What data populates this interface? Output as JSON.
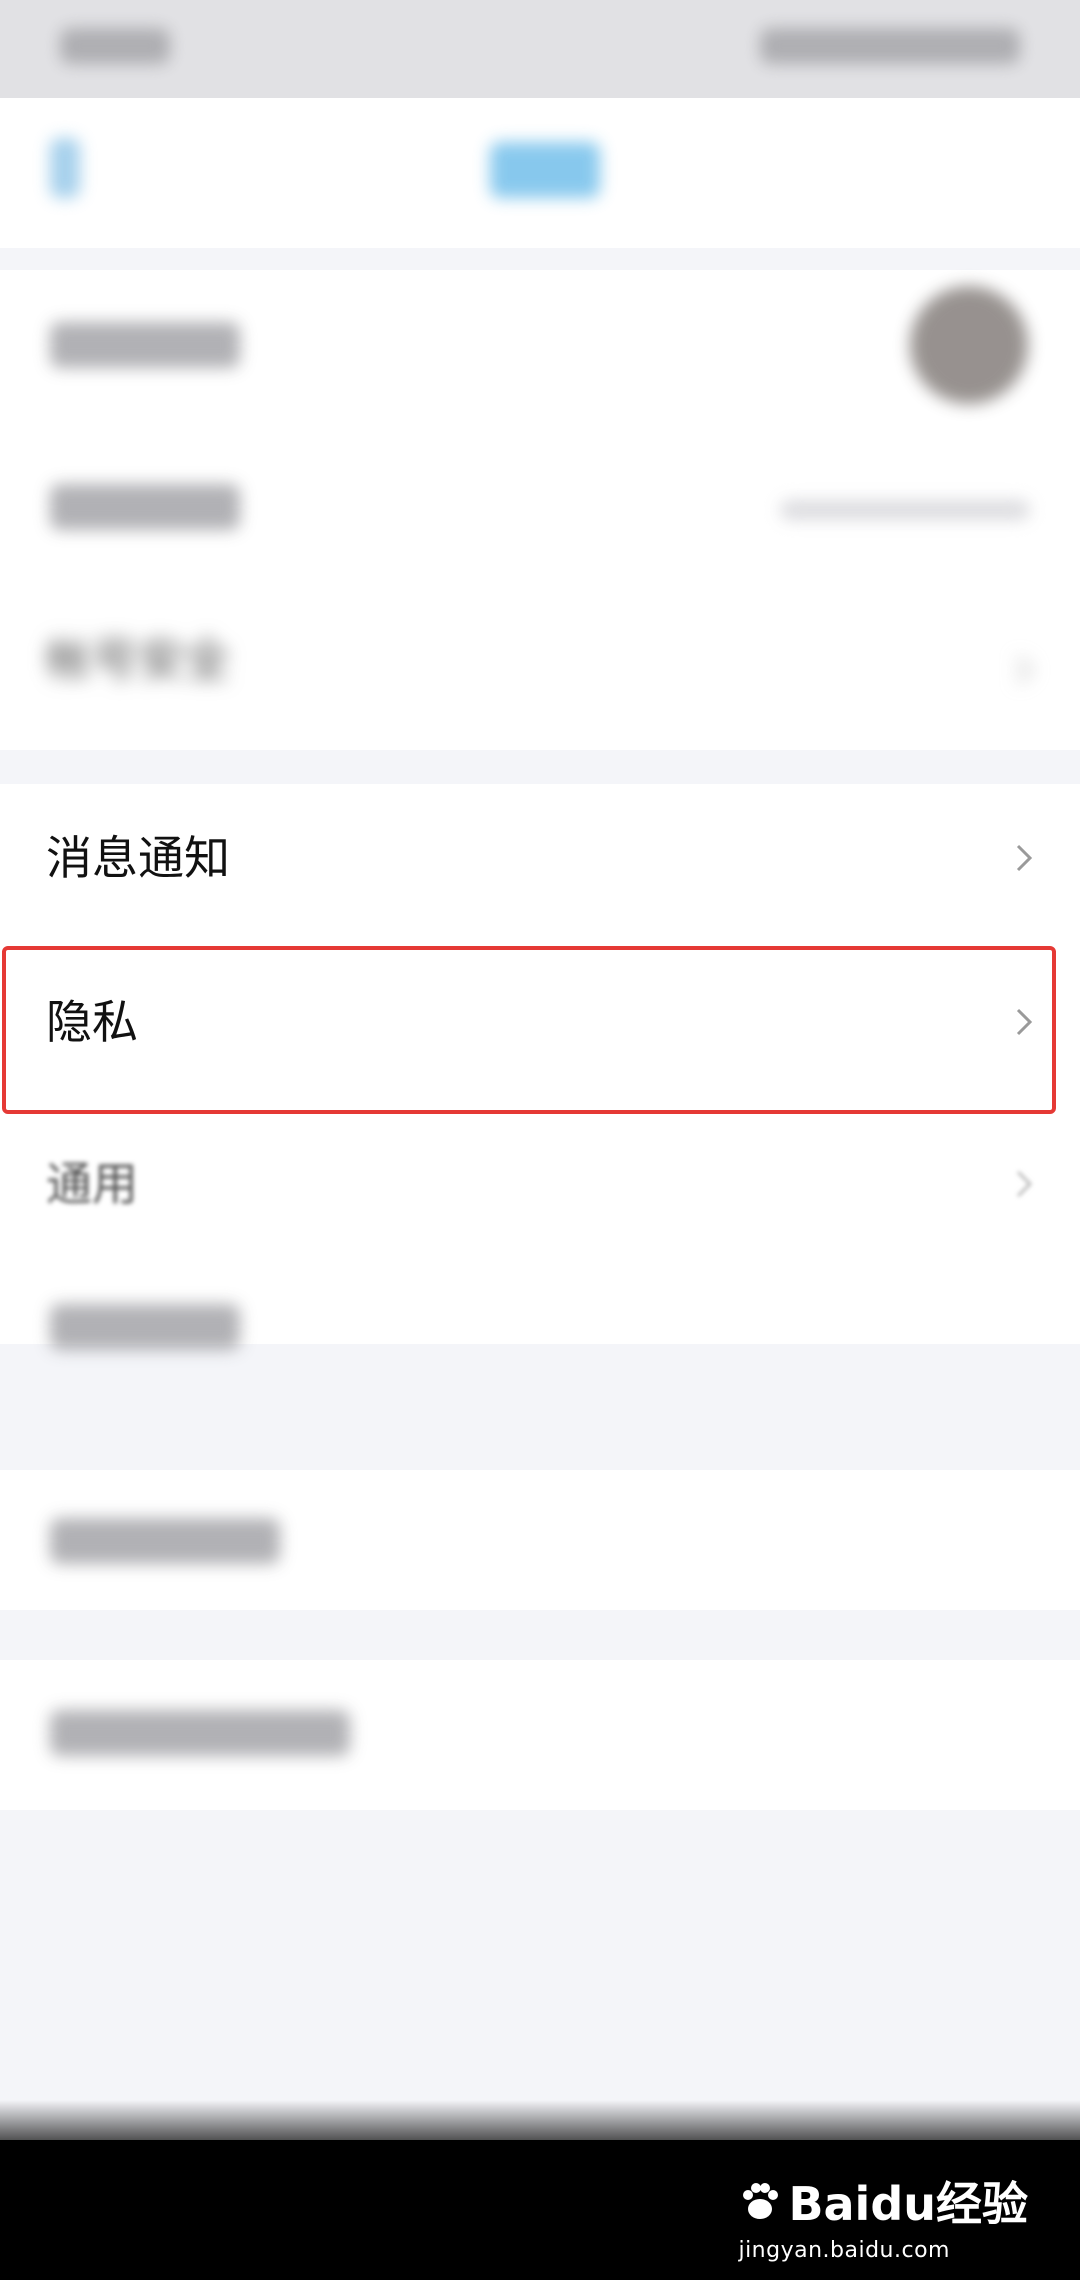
{
  "settings": {
    "account_section": {
      "items": [
        {
          "label": "帐号安全"
        }
      ]
    },
    "main_section": {
      "items": [
        {
          "label": "消息通知"
        },
        {
          "label": "隐私"
        },
        {
          "label": "通用"
        }
      ]
    }
  },
  "watermark": {
    "brand": "Baidu经验",
    "url": "jingyan.baidu.com"
  },
  "colors": {
    "highlight": "#e53935",
    "page_bg": "#f4f5f9"
  }
}
